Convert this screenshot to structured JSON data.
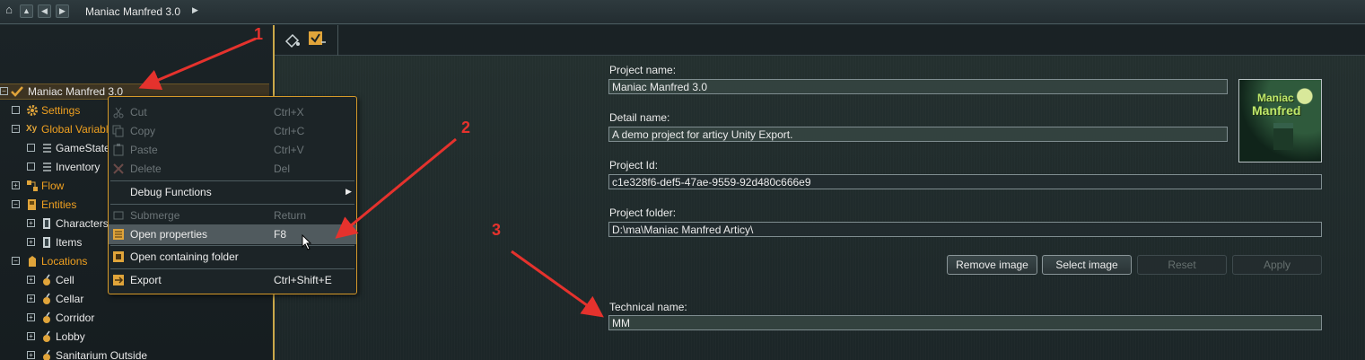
{
  "topbar": {
    "breadcrumb": "Maniac Manfred 3.0",
    "home_icon": "home-icon",
    "nav_icons": [
      "up-icon",
      "back-icon",
      "forward-icon"
    ]
  },
  "tree": {
    "root": "Maniac Manfred 3.0",
    "items": [
      {
        "label": "Settings"
      },
      {
        "label": "Global Variables"
      },
      {
        "label": "GameState"
      },
      {
        "label": "Inventory"
      },
      {
        "label": "Flow"
      },
      {
        "label": "Entities"
      },
      {
        "label": "Characters"
      },
      {
        "label": "Items"
      },
      {
        "label": "Locations"
      },
      {
        "label": "Cell"
      },
      {
        "label": "Cellar"
      },
      {
        "label": "Corridor"
      },
      {
        "label": "Lobby"
      },
      {
        "label": "Sanitarium Outside"
      }
    ]
  },
  "context_menu": {
    "cut": {
      "label": "Cut",
      "shortcut": "Ctrl+X"
    },
    "copy": {
      "label": "Copy",
      "shortcut": "Ctrl+C"
    },
    "paste": {
      "label": "Paste",
      "shortcut": "Ctrl+V"
    },
    "delete": {
      "label": "Delete",
      "shortcut": "Del"
    },
    "debug": {
      "label": "Debug Functions"
    },
    "submerge": {
      "label": "Submerge",
      "shortcut": "Return"
    },
    "open_props": {
      "label": "Open properties",
      "shortcut": "F8"
    },
    "open_folder": {
      "label": "Open containing folder"
    },
    "export": {
      "label": "Export",
      "shortcut": "Ctrl+Shift+E"
    }
  },
  "properties": {
    "project_name_label": "Project name:",
    "project_name": "Maniac Manfred 3.0",
    "detail_name_label": "Detail name:",
    "detail_name": "A demo project for articy Unity Export.",
    "project_id_label": "Project Id:",
    "project_id": "c1e328f6-def5-47ae-9559-92d480c666e9",
    "project_folder_label": "Project folder:",
    "project_folder": "D:\\ma\\Maniac Manfred Articy\\",
    "technical_name_label": "Technical name:",
    "technical_name": "MM",
    "buttons": {
      "remove_image": "Remove image",
      "select_image": "Select image",
      "reset": "Reset",
      "apply": "Apply"
    },
    "thumbnail_text_1": "Maniac",
    "thumbnail_text_2": "Manfred"
  },
  "annotations": {
    "n1": "1",
    "n2": "2",
    "n3": "3",
    "color": "#e5322d"
  }
}
